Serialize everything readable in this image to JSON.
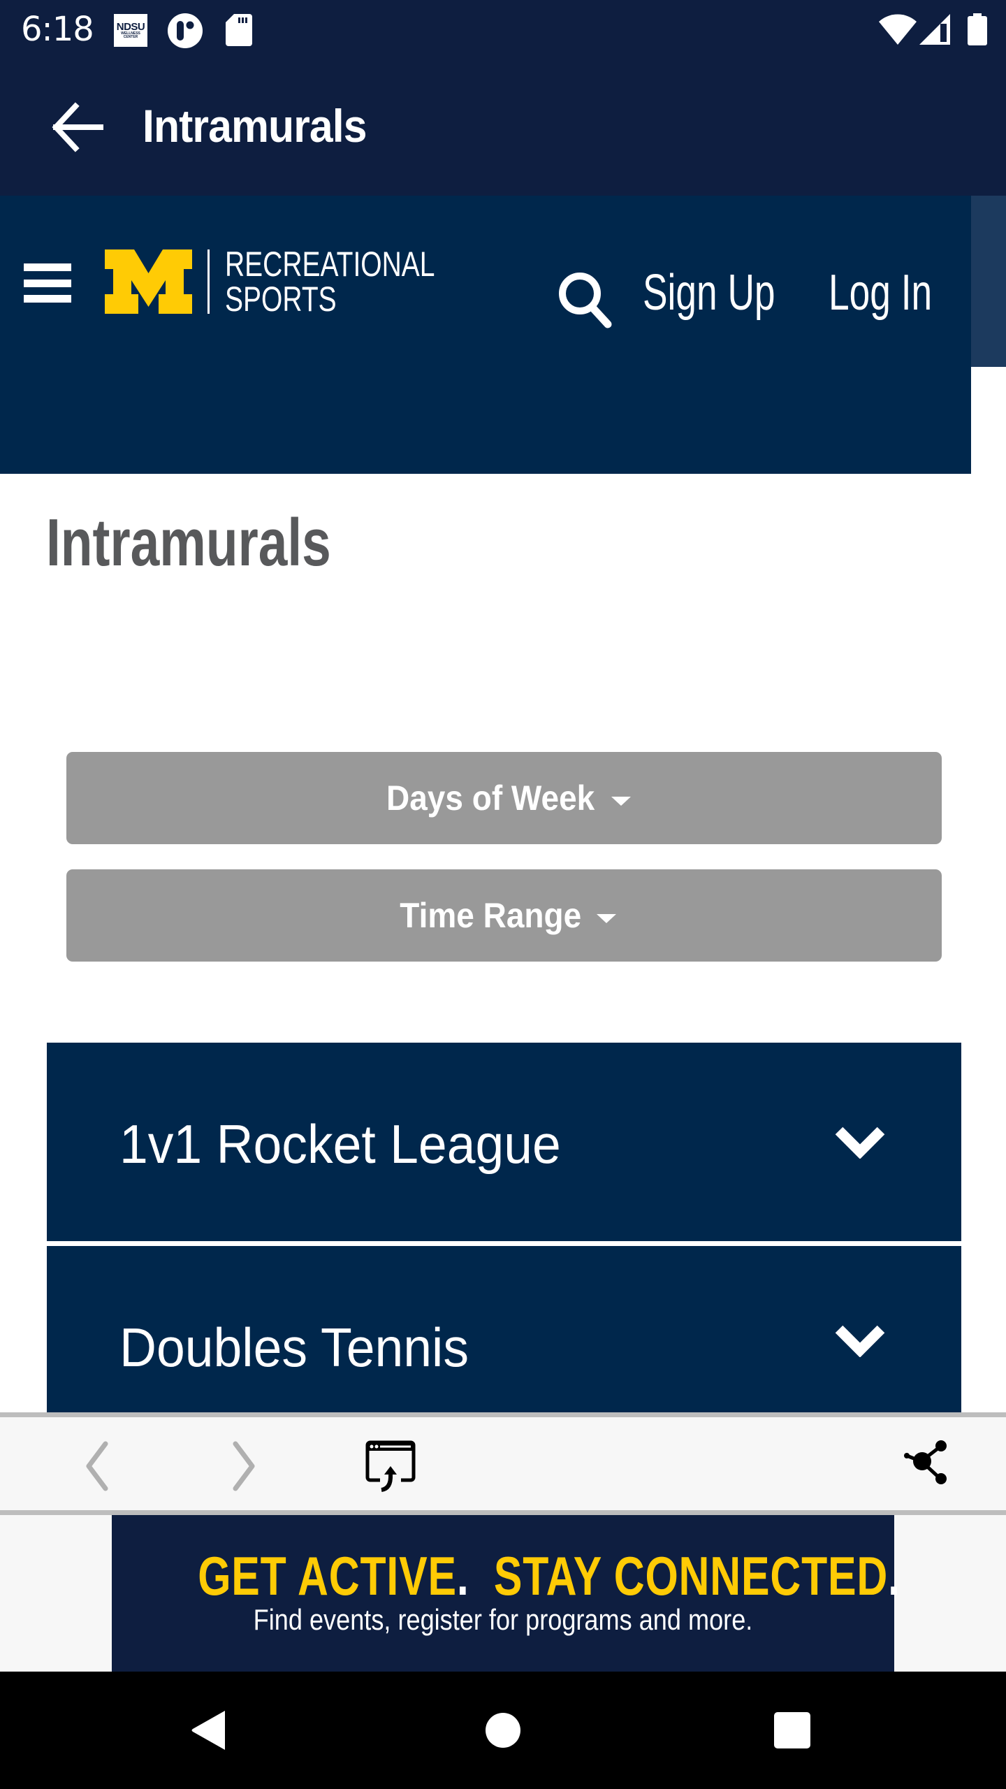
{
  "status_bar": {
    "time": "6:18",
    "notification_icons": [
      "ndsu-wellness-center-icon",
      "o-app-icon",
      "sd-card-icon"
    ],
    "ndsu_icon_text": {
      "big": "NDSU",
      "line1": "WELLNESS",
      "line2": "CENTER"
    },
    "system_icons": [
      "wifi-icon",
      "signal-icon",
      "battery-icon"
    ]
  },
  "app_bar": {
    "title": "Intramurals",
    "back_icon": "arrow-left-icon"
  },
  "web_header": {
    "logo_letter": "M",
    "logo_line1": "RECREATIONAL",
    "logo_line2": "SPORTS",
    "sign_up": "Sign Up",
    "log_in": "Log In",
    "menu_icon": "hamburger-icon",
    "search_icon": "search-icon"
  },
  "page": {
    "title": "Intramurals",
    "filters": [
      {
        "label": "Days of Week",
        "icon": "caret-down-icon"
      },
      {
        "label": "Time Range",
        "icon": "caret-down-icon"
      }
    ],
    "accordion": [
      {
        "label": "1v1 Rocket League",
        "icon": "chevron-down-icon"
      },
      {
        "label": "Doubles Tennis",
        "icon": "chevron-down-icon"
      }
    ]
  },
  "browser_toolbar": {
    "buttons": [
      "chevron-left-icon",
      "chevron-right-icon",
      "open-in-browser-icon",
      "share-icon"
    ]
  },
  "banner": {
    "headline_part1": "GET ACTIVE",
    "headline_part2": "STAY CONNECTED",
    "dot": ".",
    "subtext": "Find events, register for programs and more."
  },
  "nav_bar": {
    "buttons": [
      "nav-back-icon",
      "nav-home-icon",
      "nav-recents-icon"
    ]
  },
  "colors": {
    "status_app_bar": "#0e1e40",
    "header_navy": "#00274c",
    "maize": "#ffcb05",
    "filter_gray": "#999999",
    "title_gray": "#58595b"
  }
}
